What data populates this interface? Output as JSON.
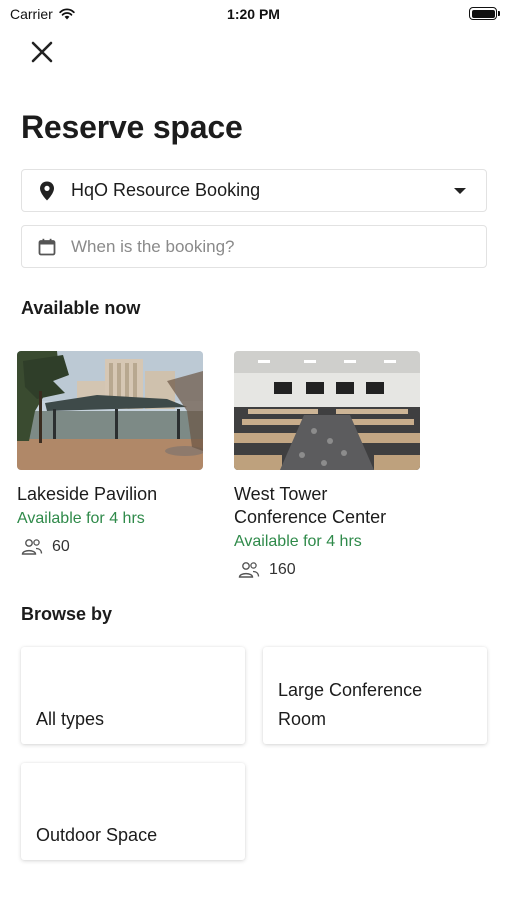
{
  "status_bar": {
    "carrier": "Carrier",
    "time": "1:20 PM"
  },
  "header": {
    "title": "Reserve space"
  },
  "location": {
    "value": "HqO Resource Booking"
  },
  "date": {
    "placeholder": "When is the booking?"
  },
  "available": {
    "title": "Available now",
    "spaces": [
      {
        "name": "Lakeside Pavilion",
        "availability": "Available for 4 hrs",
        "capacity": "60"
      },
      {
        "name": "West Tower Conference Center",
        "availability": "Available for 4 hrs",
        "capacity": "160"
      }
    ]
  },
  "browse": {
    "title": "Browse by",
    "tiles": [
      "All types",
      "Large Conference Room",
      "Outdoor Space"
    ]
  },
  "colors": {
    "available_green": "#2f8a4a",
    "text_dark": "#1c1c1c",
    "placeholder_gray": "#8a8a8a"
  }
}
